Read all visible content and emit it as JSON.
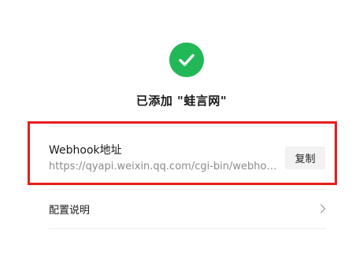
{
  "header": {
    "status_icon": "check-icon",
    "title": "已添加 \"蛙言网\""
  },
  "webhook": {
    "label": "Webhook地址",
    "url": "https://qyapi.weixin.qq.com/cgi-bin/webhook/send?key=",
    "copy_label": "复制"
  },
  "config": {
    "label": "配置说明",
    "icon": "chevron-right-icon"
  },
  "colors": {
    "success": "#22b858",
    "highlight": "#e61e1e"
  }
}
